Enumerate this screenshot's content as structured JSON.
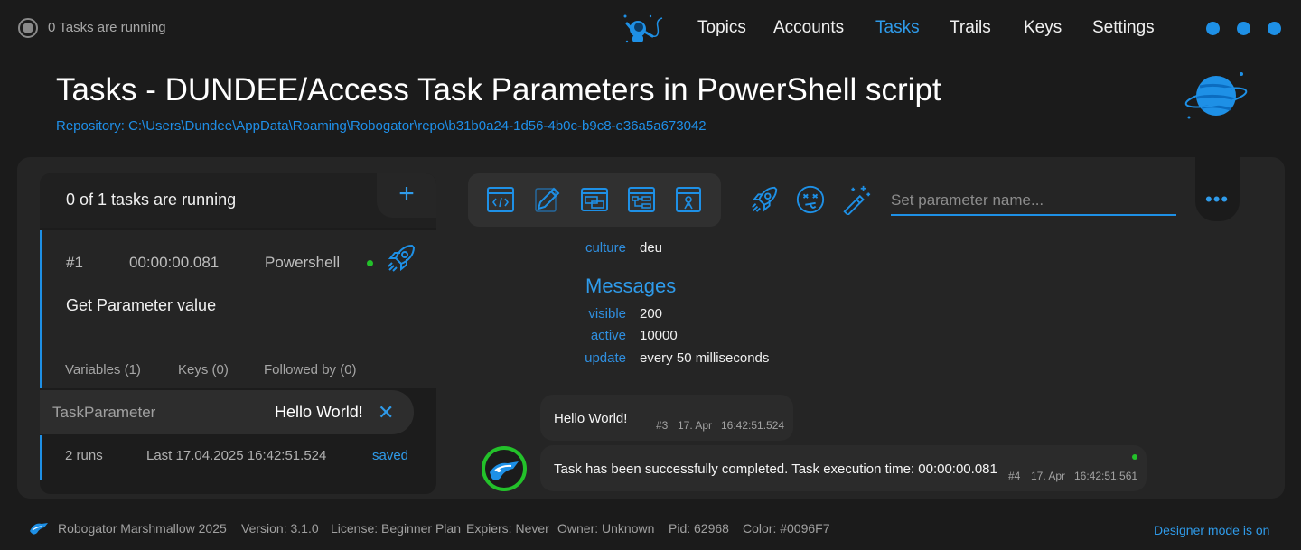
{
  "topbar": {
    "status_text": "0 Tasks are running",
    "nav": [
      "Topics",
      "Accounts",
      "Tasks",
      "Trails",
      "Keys",
      "Settings"
    ],
    "active_nav": "Tasks"
  },
  "header": {
    "title": "Tasks - DUNDEE/Access Task Parameters in PowerShell script",
    "repository": "Repository: C:\\Users\\Dundee\\AppData\\Roaming\\Robogator\\repo\\b31b0a24-1d56-4b0c-b9c8-e36a5a673042"
  },
  "tasks_panel": {
    "running_text": "0 of 1 tasks are running",
    "add_label": "+",
    "task": {
      "number": "#1",
      "duration": "00:00:00.081",
      "type": "Powershell",
      "name": "Get Parameter value",
      "tabs": [
        "Variables (1)",
        "Keys (0)",
        "Followed by (0)"
      ]
    },
    "parameter": {
      "key": "TaskParameter",
      "value": "Hello World!"
    },
    "runs": {
      "count": "2 runs",
      "last": "Last 17.04.2025 16:42:51.524",
      "status": "saved"
    }
  },
  "toolbar": {
    "param_placeholder": "Set parameter name...",
    "icons": [
      "code-window-icon",
      "edit-pen-icon",
      "windows-icon",
      "structure-icon",
      "run-script-icon"
    ],
    "actions": [
      "rocket-icon",
      "dizzy-face-icon",
      "magic-wand-icon"
    ]
  },
  "info": {
    "culture_key": "culture",
    "culture_val": "deu",
    "messages_heading": "Messages",
    "rows": [
      {
        "key": "visible",
        "value": "200"
      },
      {
        "key": "active",
        "value": "10000"
      },
      {
        "key": "update",
        "value": "every 50 milliseconds"
      }
    ]
  },
  "chat": [
    {
      "text": "Hello World!",
      "num": "#3",
      "date": "17. Apr",
      "time": "16:42:51.524"
    },
    {
      "text": "Task has been successfully completed. Task execution time: 00:00:00.081",
      "num": "#4",
      "date": "17. Apr",
      "time": "16:42:51.561"
    }
  ],
  "footer": {
    "app": "Robogator Marshmallow 2025",
    "version": "Version: 3.1.0",
    "license": "License: Beginner Plan",
    "expiers": "Expiers: Never",
    "owner": "Owner: Unknown",
    "pid": "Pid: 62968",
    "color": "Color: #0096F7",
    "designer": "Designer mode is on"
  },
  "colors": {
    "accent": "#1e90e6",
    "background": "#1b1b1b",
    "panel": "#252525",
    "success": "#23c12a"
  }
}
